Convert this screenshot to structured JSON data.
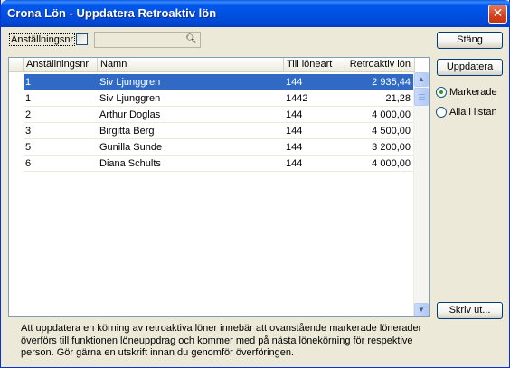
{
  "window": {
    "title": "Crona Lön - Uppdatera Retroaktiv lön",
    "close_glyph": "✕"
  },
  "filter": {
    "label": "Anställningsnr",
    "checkbox_checked": false,
    "search_value": "",
    "search_icon": "binoculars-icon"
  },
  "buttons": {
    "close_label": "Stäng",
    "update_label": "Uppdatera",
    "print_label": "Skriv ut..."
  },
  "selection": {
    "marked_label": "Markerade",
    "all_label": "Alla i listan",
    "selected": "marked"
  },
  "grid": {
    "columns": [
      "Anställningsnr",
      "Namn",
      "Till löneart",
      "Retroaktiv lön"
    ],
    "rows": [
      {
        "nr": "1",
        "name": "Siv Ljunggren",
        "art": "144",
        "lon": "2 935,44",
        "selected": true
      },
      {
        "nr": "1",
        "name": "Siv Ljunggren",
        "art": "1442",
        "lon": "21,28",
        "selected": false
      },
      {
        "nr": "2",
        "name": "Arthur Doglas",
        "art": "144",
        "lon": "4 000,00",
        "selected": false
      },
      {
        "nr": "3",
        "name": "Birgitta Berg",
        "art": "144",
        "lon": "4 500,00",
        "selected": false
      },
      {
        "nr": "5",
        "name": "Gunilla Sunde",
        "art": "144",
        "lon": "3 200,00",
        "selected": false
      },
      {
        "nr": "6",
        "name": "Diana Schults",
        "art": "144",
        "lon": "4 000,00",
        "selected": false
      }
    ]
  },
  "info": {
    "line1": "Att uppdatera en körning av retroaktiva löner innebär att ovanstående markerade lönerader",
    "line2": "överförs till funktionen löneuppdrag och kommer med på nästa lönekörning för respektive",
    "line3": "person. Gör gärna en utskrift innan du genomför överföringen."
  },
  "colors": {
    "title_bar": "#0054e3",
    "selection": "#316ac5",
    "dialog_bg": "#ece9d8"
  }
}
